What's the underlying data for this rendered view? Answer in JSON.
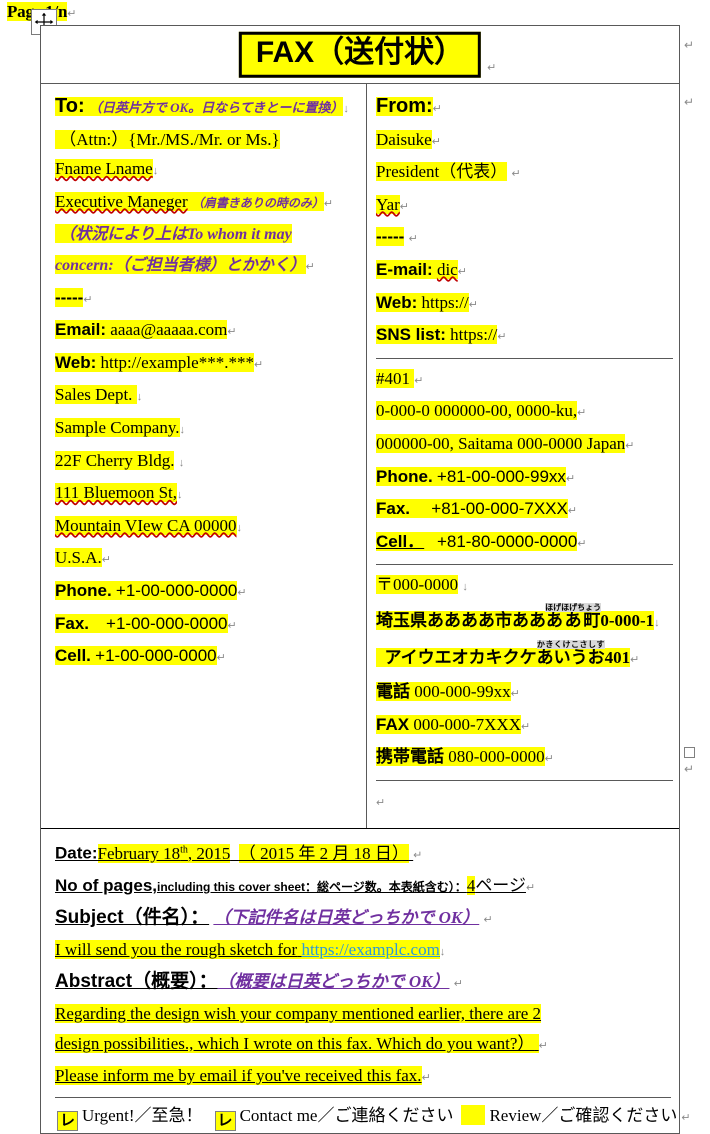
{
  "page_header": {
    "label": "Page 1/n",
    "pilcrow": "↵"
  },
  "cursor": {
    "name": "move-cursor"
  },
  "title": {
    "text": "FAX（送付状）",
    "pilcrow": "↵"
  },
  "to": {
    "heading": "To:",
    "heading_note": "（日英片方で OK。日ならてきとーに置換）",
    "attn": "（Attn:）{Mr./MS./Mr. or Ms.}",
    "name": "Fname Lname",
    "title_line": "Executive Maneger",
    "title_note": "（肩書きありの時のみ）",
    "whom_note_1": "（状況により上はTo whom it may",
    "whom_note_2": "concern:（ご担当者様）とかかく）",
    "divider": "-----",
    "email_label": "Email:",
    "email_value": "aaaa@aaaaa.com",
    "web_label": "Web:",
    "web_value": "http://example***.***",
    "dept": "Sales Dept.",
    "company": "Sample Company.",
    "bldg": "22F Cherry Bldg.",
    "street": "111 Bluemoon St,",
    "city": "Mountain VIew CA 00000",
    "country": "U.S.A.",
    "phone_label": "Phone.",
    "phone_value": "+1-00-000-0000",
    "fax_label": "Fax.",
    "fax_value": "+1-00-000-0000",
    "cell_label": "Cell.",
    "cell_value": "+1-00-000-0000"
  },
  "from": {
    "heading": "From:",
    "name": "Daisuke",
    "title_line": "President（代表）",
    "lastname": "Yar",
    "divider": "-----",
    "email_label": "E-mail:",
    "email_value": "dic",
    "web_label": "Web:",
    "web_value": "https://",
    "sns_label": "SNS list:",
    "sns_value": "https://",
    "room": "#401",
    "addr_en_1": "0-000-0 000000-00, 0000-ku,",
    "addr_en_2": "000000-00, Saitama 000-0000 Japan",
    "phone_label": "Phone.",
    "phone_value": "+81-00-000-99xx",
    "fax_label": "Fax.",
    "fax_value": "+81-00-000-7XXX",
    "cell_label": "Cell．",
    "cell_value": "+81-80-0000-0000",
    "postal": "〒000-0000",
    "addr_jp_1_a": "埼玉県ああああ市ああ",
    "addr_jp_1_ruby_base": "ああ町",
    "addr_jp_1_ruby_text": "ほげほげちょう",
    "addr_jp_1_b": "0-000-1",
    "addr_jp_2_a": "アイウエオカキクケ",
    "addr_jp_2_ruby_base": "あいうお",
    "addr_jp_2_ruby_text": "かきくけこさしす",
    "addr_jp_2_b": "401",
    "tel_jp_label": "電話",
    "tel_jp_value": "000-000-99xx",
    "fax_jp_label": "FAX",
    "fax_jp_value": "000-000-7XXX",
    "cell_jp_label": "携帯電話",
    "cell_jp_value": "080-000-0000"
  },
  "bottom": {
    "date_label": "Date:",
    "date_value_en": "February 18",
    "date_value_en_sup": "th",
    "date_value_en_rest": ", 2015",
    "date_value_jp": "（ 2015 年 2 月 18 日）",
    "pages_label": "No of pages,",
    "pages_note": "including this cover sheet：総ページ数。本表紙含む）：",
    "pages_count": "4",
    "pages_unit": "ページ",
    "subject_label": "Subject（件名）：",
    "subject_note": "（下記件名は日英どっちかで OK）",
    "subject_text": "I will send you the rough sketch for",
    "subject_link": "https://examplc.com",
    "abstract_label": "Abstract（概要）：",
    "abstract_note": "（概要は日英どっちかで OK）",
    "abstract_line_1": "Regarding the design wish your company mentioned earlier, there are 2",
    "abstract_line_2": "design possibilities., which I wrote on this fax. Which do you want?）",
    "abstract_line_3": "Please inform me by email if you've received this fax."
  },
  "checkboxes": [
    {
      "mark": "レ",
      "label": "Urgent!／至急！",
      "checked": true
    },
    {
      "mark": "レ",
      "label": "Contact me／ご連絡ください",
      "checked": true
    },
    {
      "mark": "",
      "label": "Review／ご確認ください",
      "checked": false
    }
  ],
  "marks": {
    "pilcrow": "↵",
    "arrow_down": "↓"
  },
  "colors": {
    "highlight": "#ffff00",
    "annotation": "#7030a0",
    "link": "#2e9bd6",
    "border": "#595959",
    "ruby_bg": "#d9d9d9"
  }
}
